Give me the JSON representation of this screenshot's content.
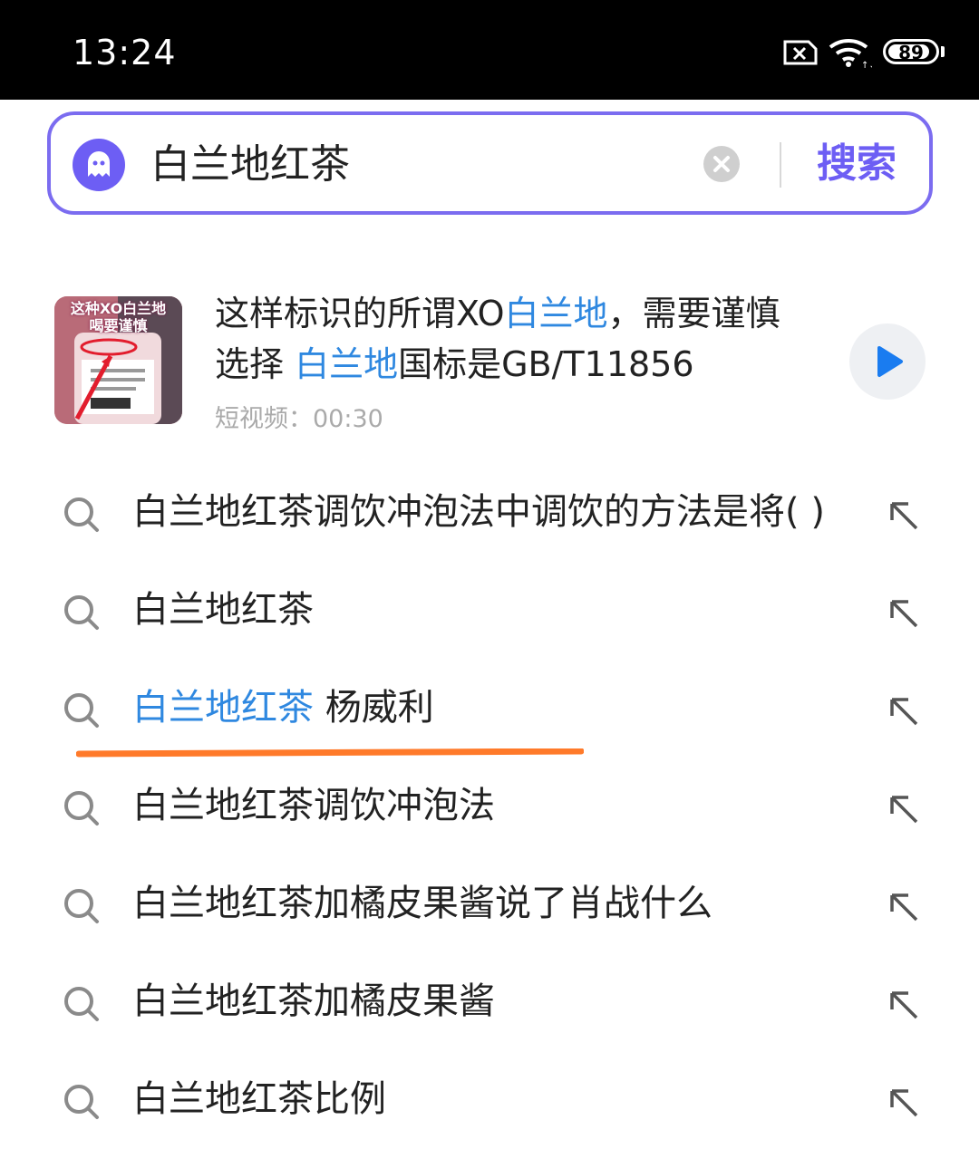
{
  "status_bar": {
    "time": "13:24",
    "battery": "89",
    "battery_level": 0.89
  },
  "search": {
    "query": "白兰地红茶",
    "button_label": "搜索"
  },
  "video_card": {
    "thumb_caption_line1": "这种XO白兰地",
    "thumb_caption_line2": "喝要谨慎",
    "title_part1": "这样标识的所谓XO",
    "title_hl1": "白兰地",
    "title_part2": "，需要谨慎",
    "title_part3": "选择 ",
    "title_hl2": "白兰地",
    "title_part4": "国标是GB/T11856",
    "meta": "短视频：00:30"
  },
  "suggestions": [
    {
      "text": "白兰地红茶调饮冲泡法中调饮的方法是将( )"
    },
    {
      "text": "白兰地红茶"
    },
    {
      "highlight": "白兰地红茶",
      "text": " 杨威利"
    },
    {
      "text": "白兰地红茶调饮冲泡法"
    },
    {
      "text": "白兰地红茶加橘皮果酱说了肖战什么"
    },
    {
      "text": "白兰地红茶加橘皮果酱"
    },
    {
      "text": "白兰地红茶比例"
    }
  ],
  "colors": {
    "accent": "#6d5ef4",
    "highlight": "#2f88e0",
    "underline": "#ff7a2a"
  },
  "icons": [
    "no-sim-icon",
    "wifi-icon",
    "battery-icon",
    "ghost-logo-icon",
    "clear-icon",
    "play-icon",
    "search-icon",
    "arrow-up-left-icon"
  ]
}
